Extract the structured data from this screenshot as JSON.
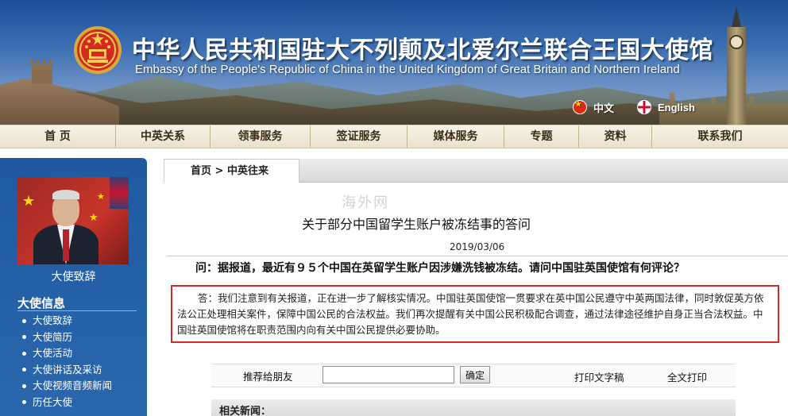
{
  "header": {
    "title_cn": "中华人民共和国驻大不列颠及北爱尔兰联合王国大使馆",
    "title_en": "Embassy of the People's Republic of China in the United Kingdom of Great Britain and Northern Ireland",
    "lang_cn": "中文",
    "lang_en": "English"
  },
  "nav": {
    "items": [
      "首 页",
      "中英关系",
      "领事服务",
      "签证服务",
      "媒体服务",
      "专题",
      "资料",
      "联系我们"
    ]
  },
  "sidebar": {
    "ambassador_caption": "大使致辞",
    "section_title": "大使信息",
    "items": [
      "大使致辞",
      "大使简历",
      "大使活动",
      "大使讲话及采访",
      "大使视频音频新闻",
      "历任大使"
    ]
  },
  "breadcrumb": "首页 > 中英往来",
  "article": {
    "watermark": "海外网",
    "title": "关于部分中国留学生账户被冻结事的答问",
    "date": "2019/03/06",
    "question": "问：据报道，最近有９５个中国在英留学生账户因涉嫌洗钱被冻结。请问中国驻英国使馆有何评论？",
    "answer": "答：我们注意到有关报道，正在进一步了解核实情况。中国驻英国使馆一贯要求在英中国公民遵守中英两国法律，同时敦促英方依法公正处理相关案件，保障中国公民的合法权益。我们再次提醒有关中国公民积极配合调查，通过法律途径维护自身正当合法权益。中国驻英国使馆将在职责范围内向有关中国公民提供必要协助。"
  },
  "share": {
    "label": "推荐给朋友",
    "input_value": "",
    "confirm": "确定",
    "print_text": "打印文字稿",
    "print_all": "全文打印"
  },
  "related": {
    "label": "相关新闻："
  },
  "colors": {
    "nav_bg": "#efe8d4",
    "sidebar_bg": "#2563a9",
    "highlight_border": "#d42a2a"
  }
}
